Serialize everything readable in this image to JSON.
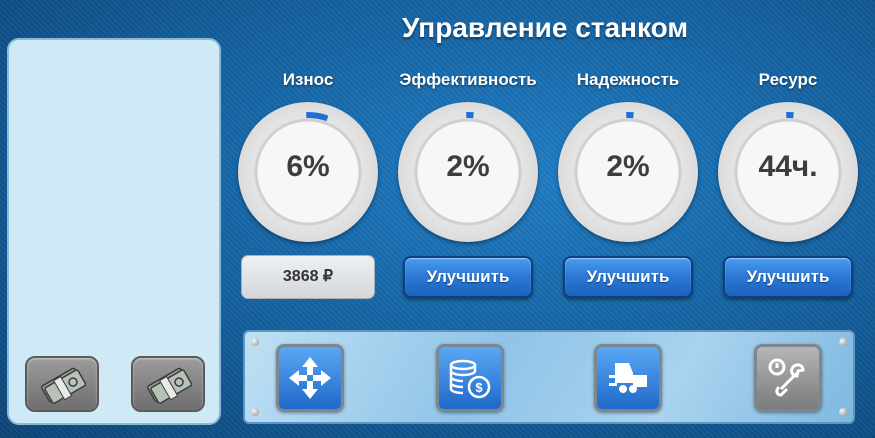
{
  "title": "Управление станком",
  "gauges": [
    {
      "label": "Износ",
      "value": "6%",
      "fill": 0.06
    },
    {
      "label": "Эффективность",
      "value": "2%",
      "fill": 0.02
    },
    {
      "label": "Надежность",
      "value": "2%",
      "fill": 0.02
    },
    {
      "label": "Ресурс",
      "value": "44ч.",
      "fill": 0.02
    }
  ],
  "price": "3868 ₽",
  "buttons": {
    "upgrade_efficiency": "Улучшить",
    "upgrade_reliability": "Улучшить",
    "upgrade_resource": "Улучшить"
  },
  "side_icons": [
    "money-icon",
    "money-icon"
  ],
  "toolbar_icons": [
    "move-arrows-icon",
    "coins-icon",
    "forklift-icon",
    "wrench-icon"
  ],
  "colors": {
    "accent": "#1f6fd6",
    "gauge_arc": "#1f6fd6"
  }
}
